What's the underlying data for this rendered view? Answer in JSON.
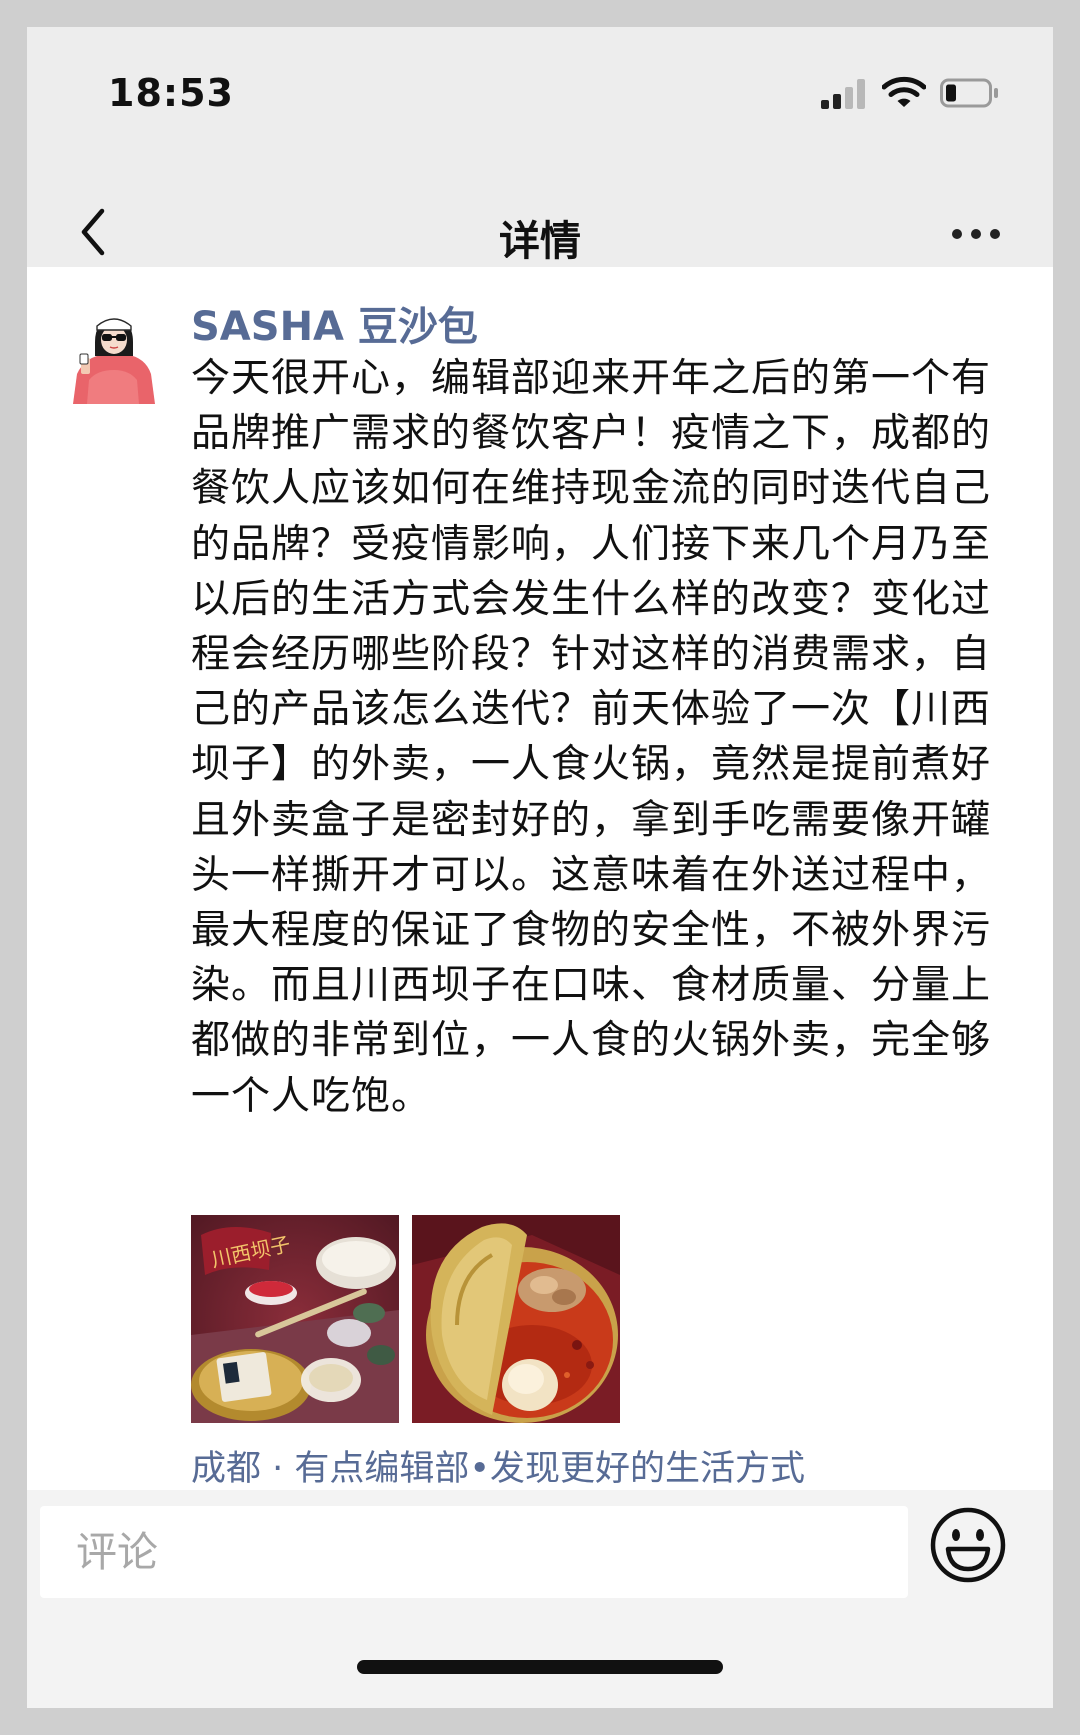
{
  "status_bar": {
    "time": "18:53",
    "signal_icon": "cellular-signal-icon",
    "wifi_icon": "wifi-icon",
    "battery_icon": "battery-icon",
    "battery_level": 0.25
  },
  "nav": {
    "title": "详情",
    "back_icon": "chevron-left-icon",
    "more_icon": "more-dots-icon"
  },
  "post": {
    "author": "SASHA 豆沙包",
    "text": "今天很开心，编辑部迎来开年之后的第一个有品牌推广需求的餐饮客户！疫情之下，成都的餐饮人应该如何在维持现金流的同时迭代自己的品牌？受疫情影响，人们接下来几个月乃至以后的生活方式会发生什么样的改变？变化过程会经历哪些阶段？针对这样的消费需求，自己的产品该怎么迭代？前天体验了一次【川西坝子】的外卖，一人食火锅，竟然是提前煮好且外卖盒子是密封好的，拿到手吃需要像开罐头一样撕开才可以。这意味着在外送过程中，最大程度的保证了食物的安全性，不被外界污染。而且川西坝子在口味、食材质量、分量上都做的非常到位，一人食的火锅外卖，完全够一个人吃饱。",
    "photo1_sign": "川西坝子",
    "location": "成都 · 有点编辑部•发现更好的生活方式"
  },
  "comment": {
    "placeholder": "评论",
    "emoji_icon": "smiley-face-icon"
  },
  "colors": {
    "link_blue": "#576b95",
    "header_bg": "#ededed",
    "bar_bg": "#f3f3f3"
  }
}
